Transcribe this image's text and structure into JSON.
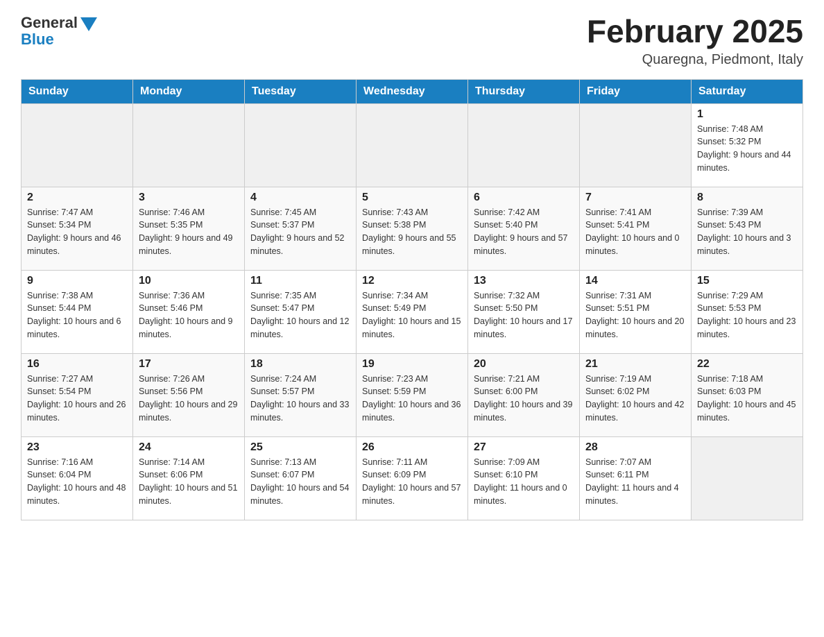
{
  "header": {
    "logo_general": "General",
    "logo_blue": "Blue",
    "month_title": "February 2025",
    "location": "Quaregna, Piedmont, Italy"
  },
  "days_of_week": [
    "Sunday",
    "Monday",
    "Tuesday",
    "Wednesday",
    "Thursday",
    "Friday",
    "Saturday"
  ],
  "weeks": [
    [
      {
        "day": "",
        "info": ""
      },
      {
        "day": "",
        "info": ""
      },
      {
        "day": "",
        "info": ""
      },
      {
        "day": "",
        "info": ""
      },
      {
        "day": "",
        "info": ""
      },
      {
        "day": "",
        "info": ""
      },
      {
        "day": "1",
        "info": "Sunrise: 7:48 AM\nSunset: 5:32 PM\nDaylight: 9 hours and 44 minutes."
      }
    ],
    [
      {
        "day": "2",
        "info": "Sunrise: 7:47 AM\nSunset: 5:34 PM\nDaylight: 9 hours and 46 minutes."
      },
      {
        "day": "3",
        "info": "Sunrise: 7:46 AM\nSunset: 5:35 PM\nDaylight: 9 hours and 49 minutes."
      },
      {
        "day": "4",
        "info": "Sunrise: 7:45 AM\nSunset: 5:37 PM\nDaylight: 9 hours and 52 minutes."
      },
      {
        "day": "5",
        "info": "Sunrise: 7:43 AM\nSunset: 5:38 PM\nDaylight: 9 hours and 55 minutes."
      },
      {
        "day": "6",
        "info": "Sunrise: 7:42 AM\nSunset: 5:40 PM\nDaylight: 9 hours and 57 minutes."
      },
      {
        "day": "7",
        "info": "Sunrise: 7:41 AM\nSunset: 5:41 PM\nDaylight: 10 hours and 0 minutes."
      },
      {
        "day": "8",
        "info": "Sunrise: 7:39 AM\nSunset: 5:43 PM\nDaylight: 10 hours and 3 minutes."
      }
    ],
    [
      {
        "day": "9",
        "info": "Sunrise: 7:38 AM\nSunset: 5:44 PM\nDaylight: 10 hours and 6 minutes."
      },
      {
        "day": "10",
        "info": "Sunrise: 7:36 AM\nSunset: 5:46 PM\nDaylight: 10 hours and 9 minutes."
      },
      {
        "day": "11",
        "info": "Sunrise: 7:35 AM\nSunset: 5:47 PM\nDaylight: 10 hours and 12 minutes."
      },
      {
        "day": "12",
        "info": "Sunrise: 7:34 AM\nSunset: 5:49 PM\nDaylight: 10 hours and 15 minutes."
      },
      {
        "day": "13",
        "info": "Sunrise: 7:32 AM\nSunset: 5:50 PM\nDaylight: 10 hours and 17 minutes."
      },
      {
        "day": "14",
        "info": "Sunrise: 7:31 AM\nSunset: 5:51 PM\nDaylight: 10 hours and 20 minutes."
      },
      {
        "day": "15",
        "info": "Sunrise: 7:29 AM\nSunset: 5:53 PM\nDaylight: 10 hours and 23 minutes."
      }
    ],
    [
      {
        "day": "16",
        "info": "Sunrise: 7:27 AM\nSunset: 5:54 PM\nDaylight: 10 hours and 26 minutes."
      },
      {
        "day": "17",
        "info": "Sunrise: 7:26 AM\nSunset: 5:56 PM\nDaylight: 10 hours and 29 minutes."
      },
      {
        "day": "18",
        "info": "Sunrise: 7:24 AM\nSunset: 5:57 PM\nDaylight: 10 hours and 33 minutes."
      },
      {
        "day": "19",
        "info": "Sunrise: 7:23 AM\nSunset: 5:59 PM\nDaylight: 10 hours and 36 minutes."
      },
      {
        "day": "20",
        "info": "Sunrise: 7:21 AM\nSunset: 6:00 PM\nDaylight: 10 hours and 39 minutes."
      },
      {
        "day": "21",
        "info": "Sunrise: 7:19 AM\nSunset: 6:02 PM\nDaylight: 10 hours and 42 minutes."
      },
      {
        "day": "22",
        "info": "Sunrise: 7:18 AM\nSunset: 6:03 PM\nDaylight: 10 hours and 45 minutes."
      }
    ],
    [
      {
        "day": "23",
        "info": "Sunrise: 7:16 AM\nSunset: 6:04 PM\nDaylight: 10 hours and 48 minutes."
      },
      {
        "day": "24",
        "info": "Sunrise: 7:14 AM\nSunset: 6:06 PM\nDaylight: 10 hours and 51 minutes."
      },
      {
        "day": "25",
        "info": "Sunrise: 7:13 AM\nSunset: 6:07 PM\nDaylight: 10 hours and 54 minutes."
      },
      {
        "day": "26",
        "info": "Sunrise: 7:11 AM\nSunset: 6:09 PM\nDaylight: 10 hours and 57 minutes."
      },
      {
        "day": "27",
        "info": "Sunrise: 7:09 AM\nSunset: 6:10 PM\nDaylight: 11 hours and 0 minutes."
      },
      {
        "day": "28",
        "info": "Sunrise: 7:07 AM\nSunset: 6:11 PM\nDaylight: 11 hours and 4 minutes."
      },
      {
        "day": "",
        "info": ""
      }
    ]
  ]
}
